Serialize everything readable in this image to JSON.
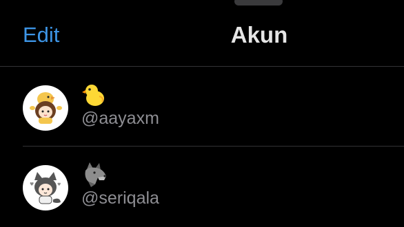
{
  "header": {
    "edit_label": "Edit",
    "title": "Akun"
  },
  "accounts": [
    {
      "display_name_icon": "chick-emoji",
      "handle": "@aayaxm"
    },
    {
      "display_name_icon": "wolf-emoji",
      "handle": "@seriqala"
    }
  ],
  "colors": {
    "background": "#000000",
    "accent": "#3d95e6",
    "secondary_text": "#8e8e93",
    "divider": "#333336"
  }
}
